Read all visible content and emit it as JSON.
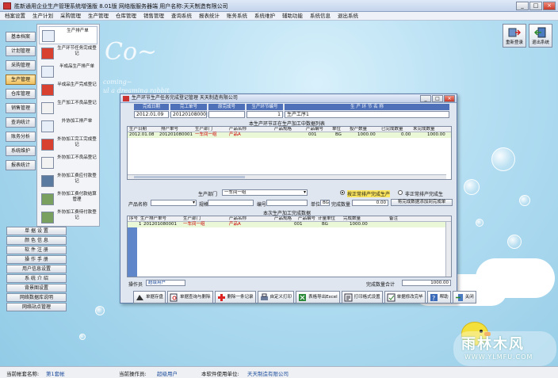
{
  "window": {
    "title": "胜新通用企业生产管理系统增强版    8.01版    网络版服务器端        用户名称:天天制造有限公司",
    "min": "_",
    "max": "□",
    "close": "×"
  },
  "menu": [
    "档案设置",
    "生产计划",
    "采购管理",
    "生产管理",
    "仓库管理",
    "销售管理",
    "查询系统",
    "报表统计",
    "账务系统",
    "系统维护",
    "辅助功能",
    "系统信息",
    "退出系统"
  ],
  "desktop": {
    "logo": "Co~",
    "slogan1": "coming~",
    "slogan2": "ul a dreaming rabbit"
  },
  "topbuttons": {
    "relogin": "重新登录",
    "exit": "退出系统"
  },
  "nav": [
    {
      "label": "基本档案",
      "active": false
    },
    {
      "label": "计划管理",
      "active": false
    },
    {
      "label": "采购管理",
      "active": false
    },
    {
      "label": "生产管理",
      "active": true
    },
    {
      "label": "仓库管理",
      "active": false
    },
    {
      "label": "销售管理",
      "active": false
    },
    {
      "label": "查询统计",
      "active": false
    },
    {
      "label": "账务分析",
      "active": false
    },
    {
      "label": "系统维护",
      "active": false
    },
    {
      "label": "报表统计",
      "active": false
    }
  ],
  "subitems": [
    "生产排产单",
    "生产环节任务完成登记",
    "半成品生产排产单",
    "半成品生产完成登记",
    "生产加工不良品登记",
    "外协加工排产单",
    "外协加工完工完成登记",
    "外协加工不良品登记",
    "外协加工费应付款登记",
    "外协加工费付款结算管理",
    "外协加工费待付款登记"
  ],
  "utils": [
    "单 据 设 置",
    "颜 色 信 息",
    "软 件 注 册",
    "操 作 手 册",
    "用户信息设置",
    "系 统 介 绍",
    "背景图设置",
    "网络数据库说明",
    "网络站点管理"
  ],
  "status": {
    "account_label": "当前帐套名称:",
    "account": "第1套帐",
    "operator_label": "当前操作员:",
    "operator": "超级用户",
    "unit_label": "本软件使用单位:",
    "unit": "天天制造有限公司"
  },
  "watermark": {
    "line1": "雨林木风",
    "line2": "WWW.YLMFU.COM"
  },
  "dialog": {
    "title": "生产环节生产任务完成登记管理          天天制造有限公司",
    "hdr_labels": [
      "完成日期",
      "完工单号",
      "原完成号",
      "生产环节编号",
      "生  产  环  节  名  称"
    ],
    "hdr_values": [
      "2012.01.09",
      "201201080001",
      "",
      "1",
      "生产工序1"
    ],
    "top_section": "本生产环节正在生产加工中数据列表",
    "top_cols": [
      "生产日期",
      "排产单号",
      "生产部门",
      "产品名称",
      "产品规格",
      "产品编号",
      "单位",
      "投产数量",
      "已完成数量",
      "未完成数量"
    ],
    "top_row": [
      "2012.01.08",
      "201201080001",
      "一车间一组",
      "产品A",
      "",
      "001",
      "BG",
      "1000.00",
      "0.00",
      "1000.00"
    ],
    "dept_label": "生产部门",
    "dept_value": "一车间一组",
    "radio1": "按正常排产完成生产",
    "radio2": "非正常排产完成生",
    "prod_label": "产品名称",
    "spec_label": "规格",
    "code_label": "编号",
    "unit_label": "单位",
    "unit_value": "BG",
    "done_label": "完成数量",
    "done_value": "0.00",
    "add_btn": "将完成数据添加到完成单",
    "bottom_section": "本次生产加工完成数据",
    "bottom_cols": [
      "序号",
      "生产排产单号",
      "生产部门",
      "产品名称",
      "产品规格",
      "产品编号",
      "计量单位",
      "完成数量",
      "备注"
    ],
    "bottom_row": [
      "1",
      "201201080001",
      "一车间一组",
      "产品A",
      "",
      "001",
      "BG",
      "1000.00",
      ""
    ],
    "operator_label": "操作员",
    "operator_value": "超级用户",
    "total_label": "完成数量合计",
    "total_value": "1000.00",
    "toolbar": [
      "单据存盘",
      "单据查询与删除",
      "删除一条记录",
      "自定义打印",
      "表格导出Excel",
      "打印格式设置",
      "单据修改完毕",
      "帮助",
      "关闭"
    ]
  }
}
